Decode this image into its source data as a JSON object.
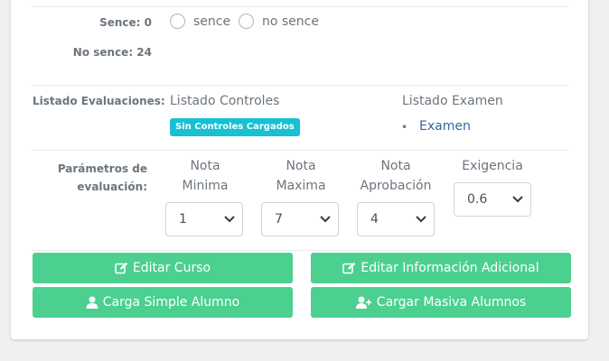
{
  "attendance": {
    "sence_label": "Sence: 0",
    "no_sence_label": "No sence: 24",
    "radio_sence": "sence",
    "radio_no_sence": "no sence"
  },
  "evaluaciones": {
    "label": "Listado Evaluaciones:",
    "controles_title": "Listado Controles",
    "controles_badge": "Sin Controles Cargados",
    "examen_title": "Listado Examen",
    "examen_link": "Examen"
  },
  "parametros": {
    "label_line1": "Parámetros de",
    "label_line2": "evaluación:",
    "columns": [
      {
        "title_line1": "Nota",
        "title_line2": "Minima",
        "value": "1"
      },
      {
        "title_line1": "Nota",
        "title_line2": "Maxima",
        "value": "7"
      },
      {
        "title_line1": "Nota",
        "title_line2": "Aprobación",
        "value": "4"
      },
      {
        "title_line1": "Exigencia",
        "title_line2": "",
        "value": "0.6"
      }
    ]
  },
  "buttons": {
    "editar_curso": "Editar Curso",
    "editar_info": "Editar Información Adicional",
    "carga_simple": "Carga Simple Alumno",
    "carga_masiva": "Cargar Masiva Alumnos"
  },
  "colors": {
    "button_green": "#4bd08f",
    "badge_cyan": "#17c1d3",
    "link_blue": "#3366aa"
  },
  "icons": {
    "edit": "edit-icon",
    "user": "user-icon",
    "user_plus": "user-plus-icon",
    "chevron": "chevron-down-icon"
  }
}
